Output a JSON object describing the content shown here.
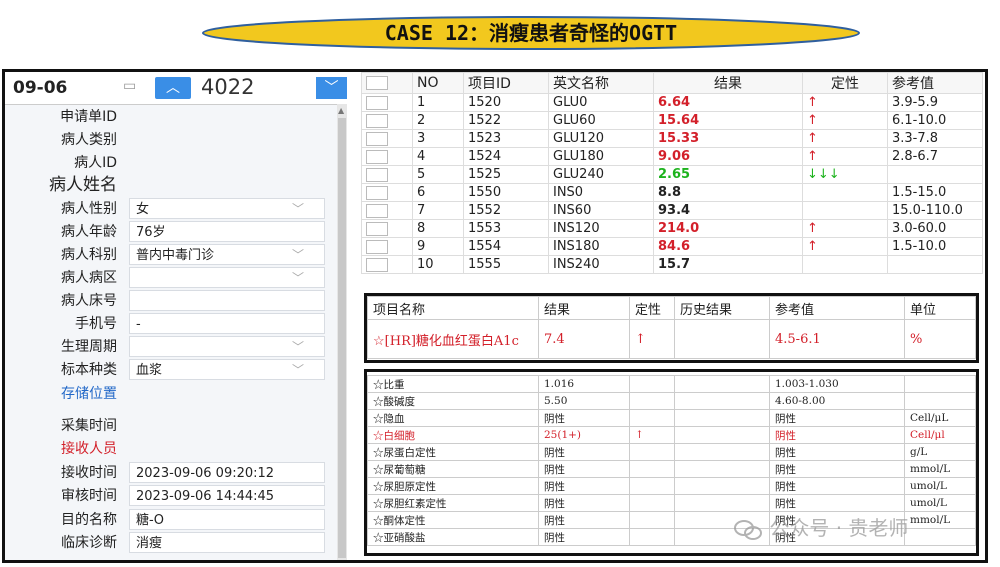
{
  "banner": {
    "title": "CASE 12：消瘦患者奇怪的OGTT"
  },
  "left": {
    "date": "09-06",
    "bed_number": "4022",
    "fields": [
      {
        "label": "申请单ID",
        "value": "",
        "style": ""
      },
      {
        "label": "病人类别",
        "value": "",
        "style": ""
      },
      {
        "label": "病人ID",
        "value": "",
        "style": ""
      },
      {
        "label": "病人姓名",
        "value": "",
        "style": "big"
      },
      {
        "label": "病人性别",
        "value": "女",
        "style": "",
        "dropdown": true
      },
      {
        "label": "病人年龄",
        "value": "76岁",
        "style": ""
      },
      {
        "label": "病人科别",
        "value": "普内中毒门诊",
        "style": "",
        "dropdown": true
      },
      {
        "label": "病人病区",
        "value": "",
        "style": "",
        "dropdown": true
      },
      {
        "label": "病人床号",
        "value": "",
        "style": ""
      },
      {
        "label": "手机号",
        "value": "-",
        "style": ""
      },
      {
        "label": "生理周期",
        "value": "",
        "style": "",
        "dropdown": true
      },
      {
        "label": "标本种类",
        "value": "血浆",
        "style": "",
        "dropdown": true
      },
      {
        "label": "存储位置",
        "value": "",
        "style": "blue"
      },
      {
        "label": "采集时间",
        "value": "",
        "style": ""
      },
      {
        "label": "接收人员",
        "value": "",
        "style": "red"
      },
      {
        "label": "接收时间",
        "value": "2023-09-06 09:20:12",
        "style": ""
      },
      {
        "label": "审核时间",
        "value": "2023-09-06 14:44:45",
        "style": ""
      },
      {
        "label": "目的名称",
        "value": "糖-O",
        "style": ""
      },
      {
        "label": "临床诊断",
        "value": "消瘦",
        "style": ""
      }
    ]
  },
  "results_table": {
    "headers": [
      "NO",
      "项目ID",
      "英文名称",
      "结果",
      "定性",
      "参考值"
    ],
    "rows": [
      {
        "no": "1",
        "id": "1520",
        "name": "GLU0",
        "result": "6.64",
        "flag": "↑",
        "ref": "3.9-5.9",
        "color": "red"
      },
      {
        "no": "2",
        "id": "1522",
        "name": "GLU60",
        "result": "15.64",
        "flag": "↑",
        "ref": "6.1-10.0",
        "color": "red"
      },
      {
        "no": "3",
        "id": "1523",
        "name": "GLU120",
        "result": "15.33",
        "flag": "↑",
        "ref": "3.3-7.8",
        "color": "red"
      },
      {
        "no": "4",
        "id": "1524",
        "name": "GLU180",
        "result": "9.06",
        "flag": "↑",
        "ref": "2.8-6.7",
        "color": "red"
      },
      {
        "no": "5",
        "id": "1525",
        "name": "GLU240",
        "result": "2.65",
        "flag": "↓↓↓",
        "ref": "",
        "color": "green"
      },
      {
        "no": "6",
        "id": "1550",
        "name": "INS0",
        "result": "8.8",
        "flag": "",
        "ref": "1.5-15.0",
        "color": "black"
      },
      {
        "no": "7",
        "id": "1552",
        "name": "INS60",
        "result": "93.4",
        "flag": "",
        "ref": "15.0-110.0",
        "color": "black"
      },
      {
        "no": "8",
        "id": "1553",
        "name": "INS120",
        "result": "214.0",
        "flag": "↑",
        "ref": "3.0-60.0",
        "color": "red"
      },
      {
        "no": "9",
        "id": "1554",
        "name": "INS180",
        "result": "84.6",
        "flag": "↑",
        "ref": "1.5-10.0",
        "color": "red"
      },
      {
        "no": "10",
        "id": "1555",
        "name": "INS240",
        "result": "15.7",
        "flag": "",
        "ref": "",
        "color": "black"
      }
    ]
  },
  "hba1c": {
    "headers": [
      "项目名称",
      "结果",
      "定性",
      "历史结果",
      "参考值",
      "单位"
    ],
    "row": {
      "name": "☆[HR]糖化血红蛋白A1c",
      "result": "7.4",
      "flag": "↑",
      "history": "",
      "ref": "4.5-6.1",
      "unit": "%"
    }
  },
  "urine": {
    "rows": [
      {
        "name": "☆比重",
        "result": "1.016",
        "flag": "",
        "ref": "1.003-1.030",
        "unit": "",
        "red": false
      },
      {
        "name": "☆酸碱度",
        "result": "5.50",
        "flag": "",
        "ref": "4.60-8.00",
        "unit": "",
        "red": false
      },
      {
        "name": "☆隐血",
        "result": "阴性",
        "flag": "",
        "ref": "阴性",
        "unit": "Cell/μL",
        "red": false
      },
      {
        "name": "☆白细胞",
        "result": "25(1+)",
        "flag": "↑",
        "ref": "阴性",
        "unit": "Cell/μl",
        "red": true
      },
      {
        "name": "☆尿蛋白定性",
        "result": "阴性",
        "flag": "",
        "ref": "阴性",
        "unit": "g/L",
        "red": false
      },
      {
        "name": "☆尿葡萄糖",
        "result": "阴性",
        "flag": "",
        "ref": "阴性",
        "unit": "mmol/L",
        "red": false
      },
      {
        "name": "☆尿胆原定性",
        "result": "阴性",
        "flag": "",
        "ref": "阴性",
        "unit": "umol/L",
        "red": false
      },
      {
        "name": "☆尿胆红素定性",
        "result": "阴性",
        "flag": "",
        "ref": "阴性",
        "unit": "umol/L",
        "red": false
      },
      {
        "name": "☆酮体定性",
        "result": "阴性",
        "flag": "",
        "ref": "阴性",
        "unit": "mmol/L",
        "red": false
      },
      {
        "name": "☆亚硝酸盐",
        "result": "阴性",
        "flag": "",
        "ref": "阴性",
        "unit": "",
        "red": false
      }
    ]
  },
  "watermark": {
    "text": "公众号 · 贵老师"
  },
  "colors": {
    "accent": "#3a8ee6",
    "abnormal_high": "#d3202a",
    "abnormal_low": "#1db31d",
    "banner_fill": "#f2c81e"
  }
}
